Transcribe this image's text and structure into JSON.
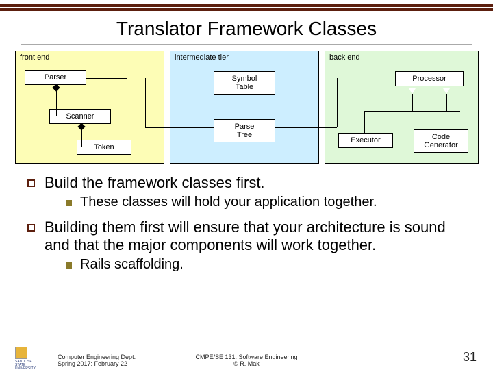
{
  "title": "Translator Framework Classes",
  "regions": {
    "front": "front end",
    "mid": "intermediate tier",
    "back": "back end"
  },
  "classes": {
    "parser": "Parser",
    "scanner": "Scanner",
    "token": "Token",
    "symbol": "Symbol\nTable",
    "ptree": "Parse\nTree",
    "processor": "Processor",
    "executor": "Executor",
    "codegen": "Code\nGenerator"
  },
  "bullets": {
    "b1": "Build the framework classes first.",
    "b1s": "These classes will hold your application together.",
    "b2": "Building them first will ensure that your architecture is sound and that the major components will work together.",
    "b2s": "Rails scaffolding."
  },
  "footer": {
    "left1": "Computer Engineering Dept.",
    "left2": "Spring 2017: February 22",
    "center1": "CMPE/SE 131: Software Engineering",
    "center2": "© R. Mak",
    "page": "31",
    "logo": "SAN JOSE STATE UNIVERSITY"
  }
}
